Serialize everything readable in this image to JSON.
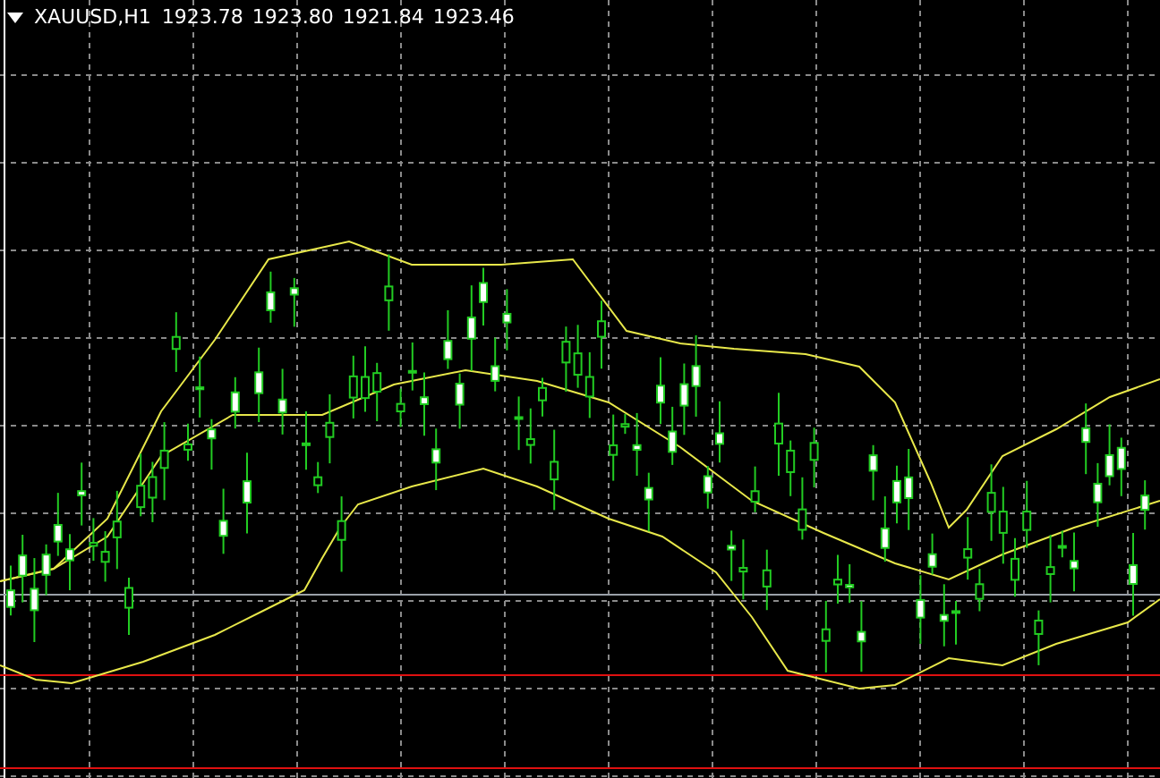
{
  "chart": {
    "symbol": "XAUUSD,H1",
    "prices": [
      "1923.78",
      "1923.80",
      "1921.84",
      "1923.46"
    ]
  }
}
